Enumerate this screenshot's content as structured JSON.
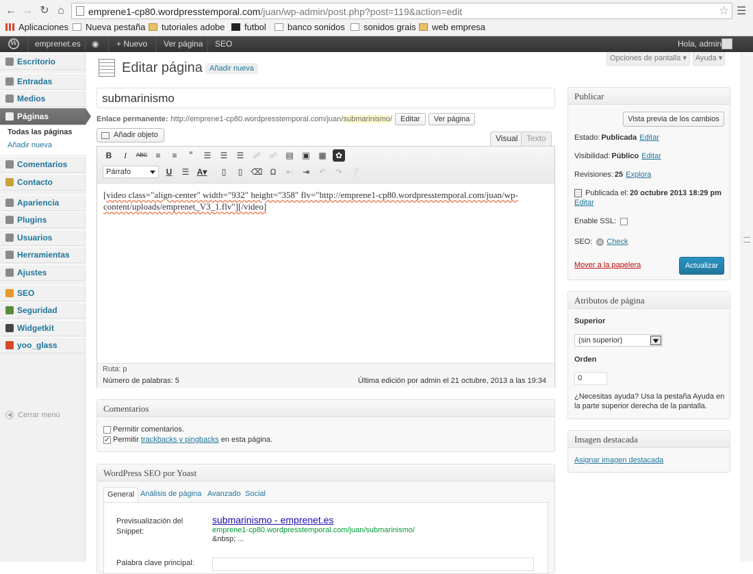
{
  "browser": {
    "url_domain": "emprene1-cp80.wordpresstemporal.com",
    "url_path": "/juan/wp-admin/post.php?post=119&action=edit",
    "bookmarks": [
      "Aplicaciones",
      "Nueva pestaña",
      "tutoriales adobe",
      "futbol",
      "banco sonidos",
      "sonidos grais",
      "web empresa"
    ]
  },
  "adminbar": {
    "site": "emprenet.es",
    "new": "Nuevo",
    "view_page": "Ver página",
    "seo": "SEO",
    "greeting": "Hola, admin"
  },
  "sidebar": {
    "items": [
      "Escritorio",
      "Entradas",
      "Medios",
      "Páginas",
      "Comentarios",
      "Contacto",
      "Apariencia",
      "Plugins",
      "Usuarios",
      "Herramientas",
      "Ajustes",
      "SEO",
      "Seguridad",
      "Widgetkit",
      "yoo_glass"
    ],
    "submenu": [
      "Todas las páginas",
      "Añadir nueva"
    ],
    "collapse": "Cerrar menú"
  },
  "header": {
    "screen_options": "Opciones de pantalla",
    "help": "Ayuda",
    "title": "Editar página",
    "add_new": "Añadir nueva"
  },
  "post": {
    "title": "submarinismo",
    "permalink_label": "Enlace permanente:",
    "permalink_base": "http://emprene1-cp80.wordpresstemporal.com/juan/",
    "permalink_slug": "submarinismo",
    "permalink_tail": "/",
    "edit_btn": "Editar",
    "view_btn": "Ver página",
    "add_media": "Añadir objeto"
  },
  "editor": {
    "tab_visual": "Visual",
    "tab_text": "Texto",
    "format": "Párrafo",
    "content_line1_a": "[",
    "content_line1_b": "video class=\"align-center\" width=\"932\" height=\"358\" flv=\"http://emprene1-cp80.wordpresstemporal.com/juan/wp-",
    "content_line2": "content/uploads/emprenet_V3_1.flv\"][/video]",
    "path": "Ruta: p",
    "word_count": "Número de palabras: 5",
    "last_edit": "Última edición por admin el 21 octubre, 2013 a las 19:34"
  },
  "comments": {
    "title": "Comentarios",
    "allow_comments": "Permitir comentarios.",
    "allow_trackbacks_pre": "Permitir",
    "allow_trackbacks_link": "trackbacks y pingbacks",
    "allow_trackbacks_post": "en esta página.",
    "trackbacks_checked": true
  },
  "seo_box": {
    "title": "WordPress SEO por Yoast",
    "tabs": [
      "General",
      "Análisis de página",
      "Avanzado",
      "Social"
    ],
    "snippet_label": "Previsualización del Snippet:",
    "snippet_title": "submarinismo - emprenet.es",
    "snippet_url": "emprene1-cp80.wordpresstemporal.com/juan/submarinismo/",
    "snippet_desc": "&nbsp; ...",
    "cut_label": "Palabra clave principal:"
  },
  "publish": {
    "title": "Publicar",
    "preview": "Vista previa de los cambios",
    "status_label": "Estado:",
    "status_value": "Publicada",
    "visibility_label": "Visibilidad:",
    "visibility_value": "Público",
    "revisions_label": "Revisiones:",
    "revisions_value": "25",
    "revisions_link": "Explora",
    "published_label": "Publicada el:",
    "published_value": "20 octubre 2013 18:29 pm",
    "edit": "Editar",
    "ssl": "Enable SSL:",
    "seo_label": "SEO:",
    "seo_check": "Check",
    "trash": "Mover a la papelera",
    "update": "Actualizar"
  },
  "attributes": {
    "title": "Atributos de página",
    "parent_label": "Superior",
    "parent_value": "(sin superior)",
    "order_label": "Orden",
    "order_value": "0",
    "help": "¿Necesitas ayuda? Usa la pestaña Ayuda en la parte superior derecha de la pantalla."
  },
  "featured": {
    "title": "Imagen destacada",
    "link": "Asignar imagen destacada"
  },
  "colors": {
    "link": "#21759b",
    "adminbar": "#464646",
    "primary_button": "#2a95c5",
    "trash": "#bc0b0b"
  }
}
